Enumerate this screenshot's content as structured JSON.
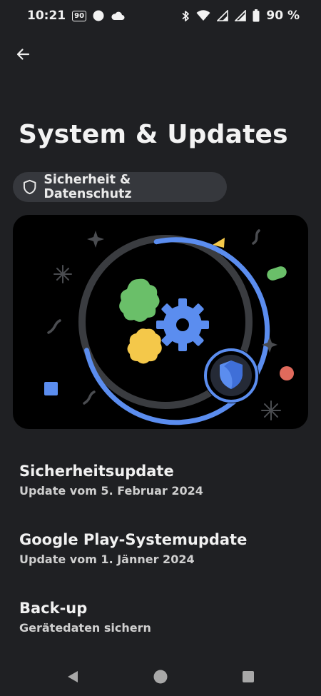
{
  "status_bar": {
    "time": "10:21",
    "badge": "90",
    "battery": "90 %",
    "icons": [
      "notification-badge-icon",
      "circle-icon",
      "cloud-icon",
      "bluetooth-icon",
      "wifi-icon",
      "signal-icon",
      "signal-icon",
      "battery-icon"
    ]
  },
  "header": {
    "back_icon": "arrow-back-icon",
    "title": "System & Updates"
  },
  "chip": {
    "icon": "shield-icon",
    "label": "Sicherheit & Datenschutz"
  },
  "hero": {
    "illustration": "system-updates-illustration",
    "colors": {
      "blue": "#5b8def",
      "green": "#6abf69",
      "yellow": "#f4c84a",
      "red": "#e06a5c",
      "ring_dark": "#3a3c40"
    }
  },
  "items": [
    {
      "title": "Sicherheitsupdate",
      "subtitle": "Update vom 5. Februar 2024"
    },
    {
      "title": "Google Play-Systemupdate",
      "subtitle": "Update vom 1. Jänner 2024"
    },
    {
      "title": "Back-up",
      "subtitle": "Gerätedaten sichern"
    }
  ],
  "nav": {
    "back_icon": "nav-back-icon",
    "home_icon": "nav-home-icon",
    "recents_icon": "nav-recents-icon"
  },
  "colors": {
    "background": "#1f2023",
    "chip_bg": "#36383d",
    "text_primary": "#f1f1f1",
    "text_secondary": "#cfcfcf"
  }
}
